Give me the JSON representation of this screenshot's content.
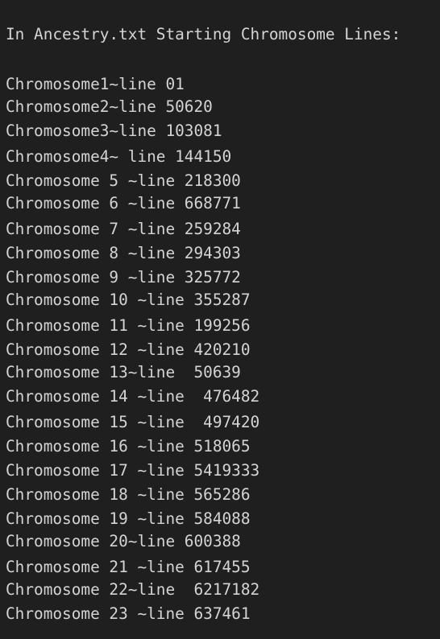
{
  "editor": {
    "heading": "In Ancestry.txt Starting Chromosome Lines:",
    "lines": [
      "Chromosome1~line 01",
      "Chromosome2~line 50620",
      "Chromosome3~line 103081",
      "Chromosome4~ line 144150",
      "Chromosome 5 ~line 218300",
      "Chromosome 6 ~line 668771",
      "Chromosome 7 ~line 259284",
      "Chromosome 8 ~line 294303",
      "Chromosome 9 ~line 325772",
      "Chromosome 10 ~line 355287",
      "Chromosome 11 ~line 199256",
      "Chromosome 12 ~line 420210",
      "Chromosome 13~line  50639",
      "Chromosome 14 ~line  476482",
      "Chromosome 15 ~line  497420",
      "Chromosome 16 ~line 518065",
      "Chromosome 17 ~line 5419333",
      "Chromosome 18 ~line 565286",
      "Chromosome 19 ~line 584088",
      "Chromosome 20~line 600388",
      "Chromosome 21 ~line 617455",
      "Chromosome 22~line  6217182",
      "Chromosome 23 ~line 637461"
    ]
  }
}
